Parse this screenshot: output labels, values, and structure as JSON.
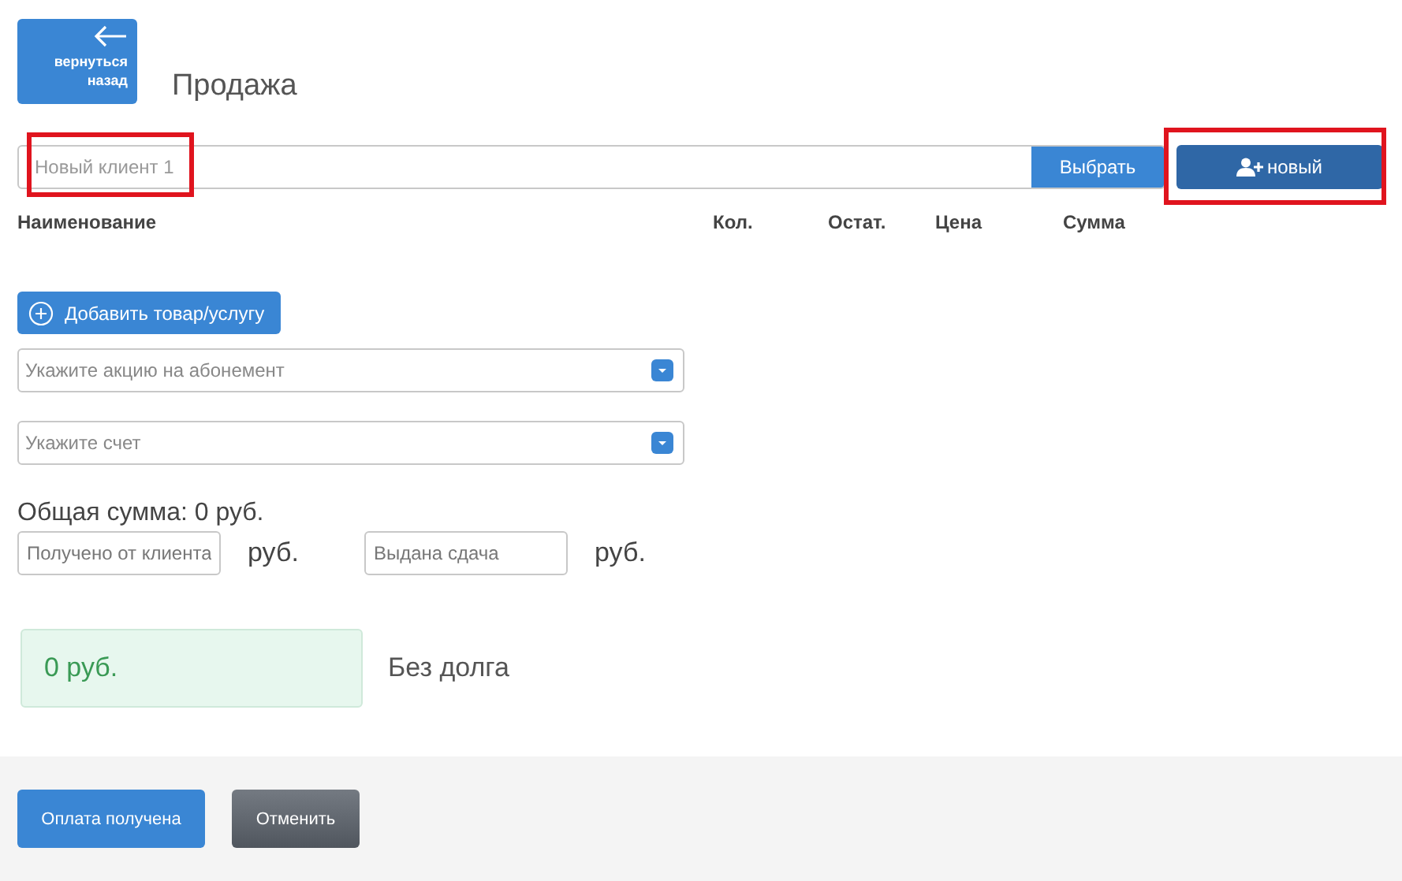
{
  "back_button": {
    "label": [
      "вернуться",
      "назад"
    ]
  },
  "title": "Продажа",
  "client": {
    "value": "Новый клиент 1",
    "highlighted": true,
    "select_button": "Выбрать"
  },
  "new_button": {
    "label": "новый",
    "highlighted": true
  },
  "table": {
    "columns": [
      "Наименование",
      "Кол.",
      "Остат.",
      "Цена",
      "Сумма"
    ]
  },
  "add_button": "Добавить товар/услугу",
  "selects": [
    {
      "placeholder": "Укажите акцию на абонемент"
    },
    {
      "placeholder": "Укажите счет"
    }
  ],
  "total": "Общая сумма: 0 руб.",
  "payment_fields": [
    {
      "placeholder": "Получено от клиента",
      "unit": "руб."
    },
    {
      "placeholder": "Выдана сдача",
      "unit": "руб."
    }
  ],
  "debt": {
    "amount": "0 руб.",
    "status": "Без долга"
  },
  "footer_buttons": [
    {
      "label": "Оплата получена",
      "kind": "primary"
    },
    {
      "label": "Отменить",
      "kind": "secondary"
    }
  ]
}
